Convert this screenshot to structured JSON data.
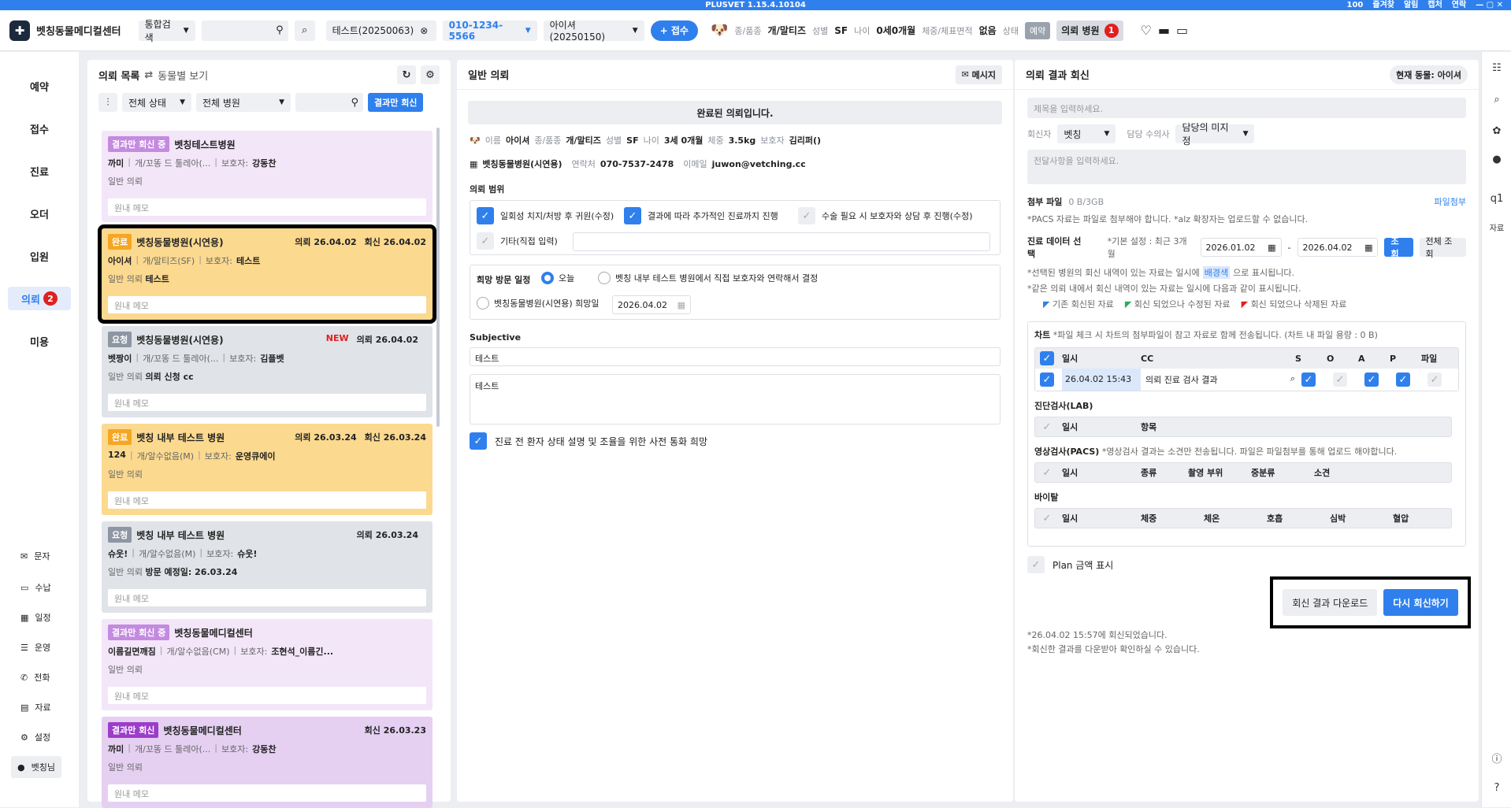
{
  "app": {
    "version": "PLUSVET 1.15.4.10104",
    "zoom": "100",
    "links": [
      "즐겨찾",
      "알림",
      "캡처",
      "연락"
    ]
  },
  "header": {
    "clinic": "벳칭동물메디컬센터",
    "search_mode": "통합검색",
    "patient_tab": "테스트(20250063)",
    "phone": "010-1234-5566",
    "patient_select": "아이셔(20250150)",
    "register": "접수",
    "species_label": "종/품종",
    "species": "개/말티즈",
    "sex_label": "성별",
    "sex": "SF",
    "age_label": "나이",
    "age": "0세0개월",
    "weight_label": "체중/체표면적",
    "weight": "없음",
    "status_label": "상태",
    "status": "예약",
    "referral_hosp": "의뢰 병원",
    "referral_count": "1"
  },
  "nav": {
    "items": [
      "예약",
      "접수",
      "진료",
      "오더",
      "입원",
      "의뢰",
      "미용"
    ],
    "active": "의뢰",
    "badge": "2",
    "sub": [
      "문자",
      "수납",
      "일정",
      "운영",
      "전화",
      "자료",
      "설정",
      "벳칭님"
    ]
  },
  "left": {
    "title": "의뢰 목록",
    "switch": "동물별 보기",
    "status_filter": "전체 상태",
    "hosp_filter": "전체 병원",
    "result_btn": "결과만 회신",
    "cards": [
      {
        "status": "결과만 회신 중",
        "hospital": "벳칭테스트병원",
        "pet": "까미",
        "breed": "개/꼬똥 드 툴레아(...",
        "owner_label": "보호자:",
        "owner": "강동찬",
        "type": "일반 의뢰",
        "extra": "",
        "memo": "원내 메모",
        "date1": "",
        "date2": "",
        "new": ""
      },
      {
        "status": "완료",
        "hospital": "벳칭동물병원(시연용)",
        "pet": "아이셔",
        "breed": "개/말티즈(SF)",
        "owner_label": "보호자:",
        "owner": "테스트",
        "type": "일반 의뢰",
        "extra": "테스트",
        "memo": "원내 메모",
        "date1": "의뢰 26.04.02",
        "date2": "회신 26.04.02",
        "new": ""
      },
      {
        "status": "요청",
        "hospital": "벳칭동물병원(시연용)",
        "pet": "벳짱이",
        "breed": "개/꼬똥 드 툴레아(...",
        "owner_label": "보호자:",
        "owner": "김플벳",
        "type": "일반 의뢰",
        "extra": "의뢰 신청 cc",
        "memo": "원내 메모",
        "date1": "의뢰 26.04.02",
        "date2": "",
        "new": "NEW"
      },
      {
        "status": "완료",
        "hospital": "벳칭 내부 테스트 병원",
        "pet": "124",
        "breed": "개/알수없음(M)",
        "owner_label": "보호자:",
        "owner": "운영큐에이",
        "type": "일반 의뢰",
        "extra": "",
        "memo": "원내 메모",
        "date1": "의뢰 26.03.24",
        "date2": "회신 26.03.24",
        "new": ""
      },
      {
        "status": "요청",
        "hospital": "벳칭 내부 테스트 병원",
        "pet": "슈웃!",
        "breed": "개/알수없음(M)",
        "owner_label": "보호자:",
        "owner": "슈웃!",
        "type": "일반 의뢰",
        "extra": "방문 예정일: 26.03.24",
        "memo": "원내 메모",
        "date1": "의뢰 26.03.24",
        "date2": "",
        "new": ""
      },
      {
        "status": "결과만 회신 중",
        "hospital": "벳칭동물메디컬센터",
        "pet": "이름길면깨짐",
        "breed": "개/알수없음(CM)",
        "owner_label": "보호자:",
        "owner": "조현석_이름긴...",
        "type": "일반 의뢰",
        "extra": "",
        "memo": "원내 메모",
        "date1": "",
        "date2": "",
        "new": ""
      },
      {
        "status": "결과만 회신",
        "hospital": "벳칭동물메디컬센터",
        "pet": "까미",
        "breed": "개/꼬똥 드 툴레아(...",
        "owner_label": "보호자:",
        "owner": "강동찬",
        "type": "일반 의뢰",
        "extra": "",
        "memo": "원내 메모",
        "date1": "",
        "date2": "회신 26.03.23",
        "new": ""
      }
    ]
  },
  "mid": {
    "title": "일반 의뢰",
    "msg_btn": "메시지",
    "done": "완료된 의뢰입니다.",
    "name_label": "이름",
    "name": "아이셔",
    "species_label": "종/품종",
    "species": "개/말티즈",
    "sex_label": "성별",
    "sex": "SF",
    "age_label": "나이",
    "age": "3세 0개월",
    "weight_label": "체중",
    "weight": "3.5kg",
    "guardian_label": "보호자",
    "guardian": "김리퍼()",
    "hosp": "벳칭동물병원(시연용)",
    "contact_label": "연락처",
    "contact": "070-7537-2478",
    "email_label": "이메일",
    "email": "juwon@vetching.cc",
    "scope_title": "의뢰 범위",
    "scope": [
      "일회성 치지/처방 후 귀원(수정)",
      "결과에 따라 추가적인 진료까지 진행",
      "수술 필요 시 보호자와 상담 후 진행(수정)",
      "기타(직접 입력)"
    ],
    "visit_title": "희망 방문 일정",
    "visit_opts": [
      "오늘",
      "벳칭 내부 테스트 병원에서 직접 보호자와 연락해서 결정",
      "벳칭동물병원(시연용) 희망일"
    ],
    "visit_date": "2026.04.02",
    "subj_title": "Subjective",
    "subj1": "테스트",
    "subj2": "테스트",
    "call": "진료 전 환자 상태 설명 및 조율을 위한 사전 통화 희망"
  },
  "right": {
    "title": "의뢰 결과 회신",
    "current": "현재 동물: 아이셔",
    "title_ph": "제목을 입력하세요.",
    "replier_label": "회신자",
    "replier": "벳칭",
    "vet_label": "담당 수의사",
    "vet": "담당의 미지정",
    "msg_ph": "전달사항을 입력하세요.",
    "attach_label": "첨부 파일",
    "attach_size": "0 B/3GB",
    "attach_btn": "파일첨부",
    "attach_note": "*PACS 자료는 파일로 첨부해야 합니다.  *alz 확장자는 업로드할 수 없습니다.",
    "data_label": "진료 데이터 선택",
    "default_set": "*기본 설정 : 최근 3개월",
    "date_from": "2026.01.02",
    "date_to": "2026.04.02",
    "query": "조회",
    "query_all": "전체 조회",
    "note1a": "*선택된 병원의 회신 내역이 있는 자료는 일시에",
    "note1b": "배경색",
    "note1c": "으로 표시됩니다.",
    "note2": "*같은 의뢰 내에서 회신 내역이 있는 자료는 일시에 다음과 같이 표시됩니다.",
    "legend": [
      "기존 회신된 자료",
      "회신 되었으나 수정된 자료",
      "회신 되었으나 삭제된 자료"
    ],
    "chart_label": "차트",
    "chart_note": "*파일 체크 시 차트의 첨부파일이 참고 자료로 함께 전송됩니다. (차트 내 파일 용량 : 0 B)",
    "chart_cols": [
      "일시",
      "CC",
      "S",
      "O",
      "A",
      "P",
      "파일"
    ],
    "chart_row": {
      "date": "26.04.02 15:43",
      "cc": "의뢰 진료 검사 결과"
    },
    "lab_label": "진단검사(LAB)",
    "lab_cols": [
      "일시",
      "항목"
    ],
    "pacs_label": "영상검사(PACS)",
    "pacs_note": "*영상검사 결과는 소견만 전송됩니다. 파일은 파일첨부를 통해 업로드 해야합니다.",
    "pacs_cols": [
      "일시",
      "종류",
      "촬영 부위",
      "중분류",
      "소견"
    ],
    "vital_label": "바이탈",
    "vital_cols": [
      "일시",
      "체중",
      "체온",
      "호흡",
      "심박",
      "혈압"
    ],
    "plan": "Plan 금액 표시",
    "download": "회신 결과 다운로드",
    "resend": "다시 회신하기",
    "foot1": "*26.04.02 15:57에 회신되었습니다.",
    "foot2": "*회신한 결과를 다운받아 확인하실 수 있습니다."
  }
}
